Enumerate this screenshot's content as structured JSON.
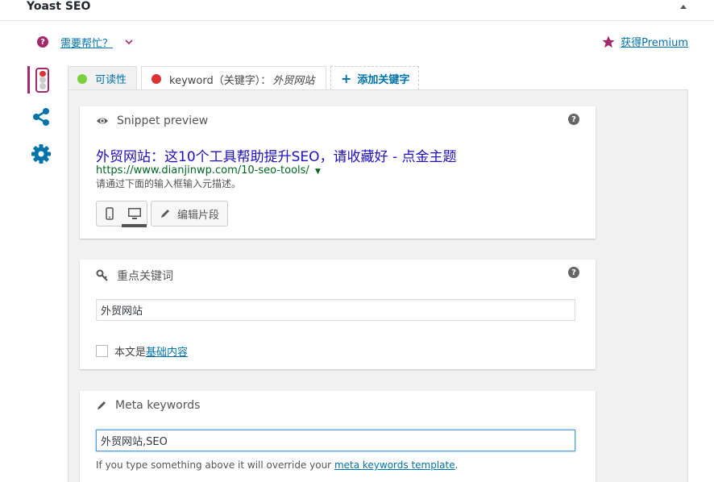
{
  "header": {
    "title": "Yoast SEO",
    "toggle_icon": "triangle-up-icon"
  },
  "help": {
    "icon": "question-icon",
    "label": "需要帮忙？",
    "chevron": "chevron-down-icon"
  },
  "premium": {
    "icon": "star-icon",
    "label": "获得Premium"
  },
  "sidebar": {
    "tabs": [
      {
        "name": "readability-traffic-light",
        "active": true
      },
      {
        "name": "share-icon",
        "active": false
      },
      {
        "name": "gear-icon",
        "active": false
      }
    ]
  },
  "tabs": {
    "readability": {
      "label": "可读性",
      "status_color": "#7ad03a"
    },
    "keyword": {
      "label_prefix": "keyword（关键字）：",
      "label_value": "外贸网站",
      "status_color": "#dc3232"
    },
    "add": {
      "icon": "+",
      "label": "添加关键字"
    }
  },
  "snippet": {
    "heading": "Snippet preview",
    "title": "外贸网站：这10个工具帮助提升SEO，请收藏好 - 点金主题",
    "url": "https://www.dianjinwp.com/10-seo-tools/",
    "description": "请通过下面的输入框输入元描述。",
    "edit_label": "编辑片段"
  },
  "focus_keyword": {
    "heading": "重点关键词",
    "value": "外贸网站",
    "cornerstone_prefix": "本文是",
    "cornerstone_link": "基础内容",
    "cornerstone_checked": false
  },
  "meta_keywords": {
    "heading": "Meta keywords",
    "value": "外贸网站,SEO",
    "note_prefix": "If you type something above it will override your ",
    "note_link": "meta keywords template",
    "note_suffix": "."
  },
  "colors": {
    "accent": "#a4286a",
    "link": "#0073aa",
    "snippet_title": "#1e0fbe",
    "snippet_url": "#006621"
  }
}
